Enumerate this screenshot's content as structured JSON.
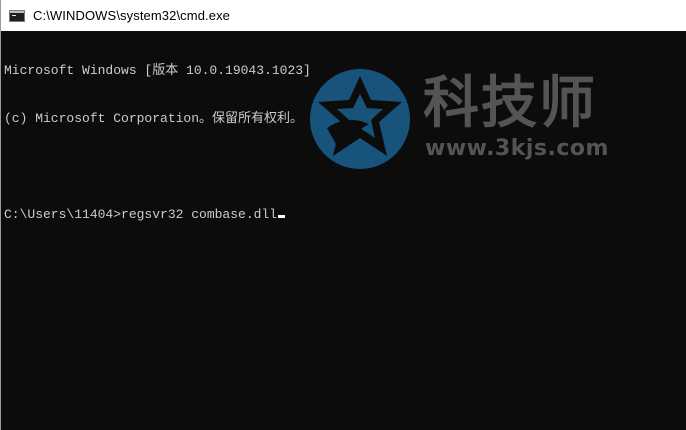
{
  "window": {
    "title": "C:\\WINDOWS\\system32\\cmd.exe",
    "icon": "cmd-console-icon"
  },
  "console": {
    "lines": [
      "Microsoft Windows [版本 10.0.19043.1023]",
      "(c) Microsoft Corporation。保留所有权利。",
      "",
      "C:\\Users\\11404>regsvr32 combase.dll"
    ],
    "cursor": "blinking-underscore"
  },
  "watermark": {
    "title": "科技师",
    "url": "www.3kjs.com",
    "logo": "star-circle-logo"
  },
  "colors": {
    "console_bg": "#0c0c0c",
    "console_text": "#cccccc",
    "titlebar_bg": "#ffffff",
    "watermark_blue": "#1a5a85",
    "watermark_gray": "#5b5b5b"
  }
}
